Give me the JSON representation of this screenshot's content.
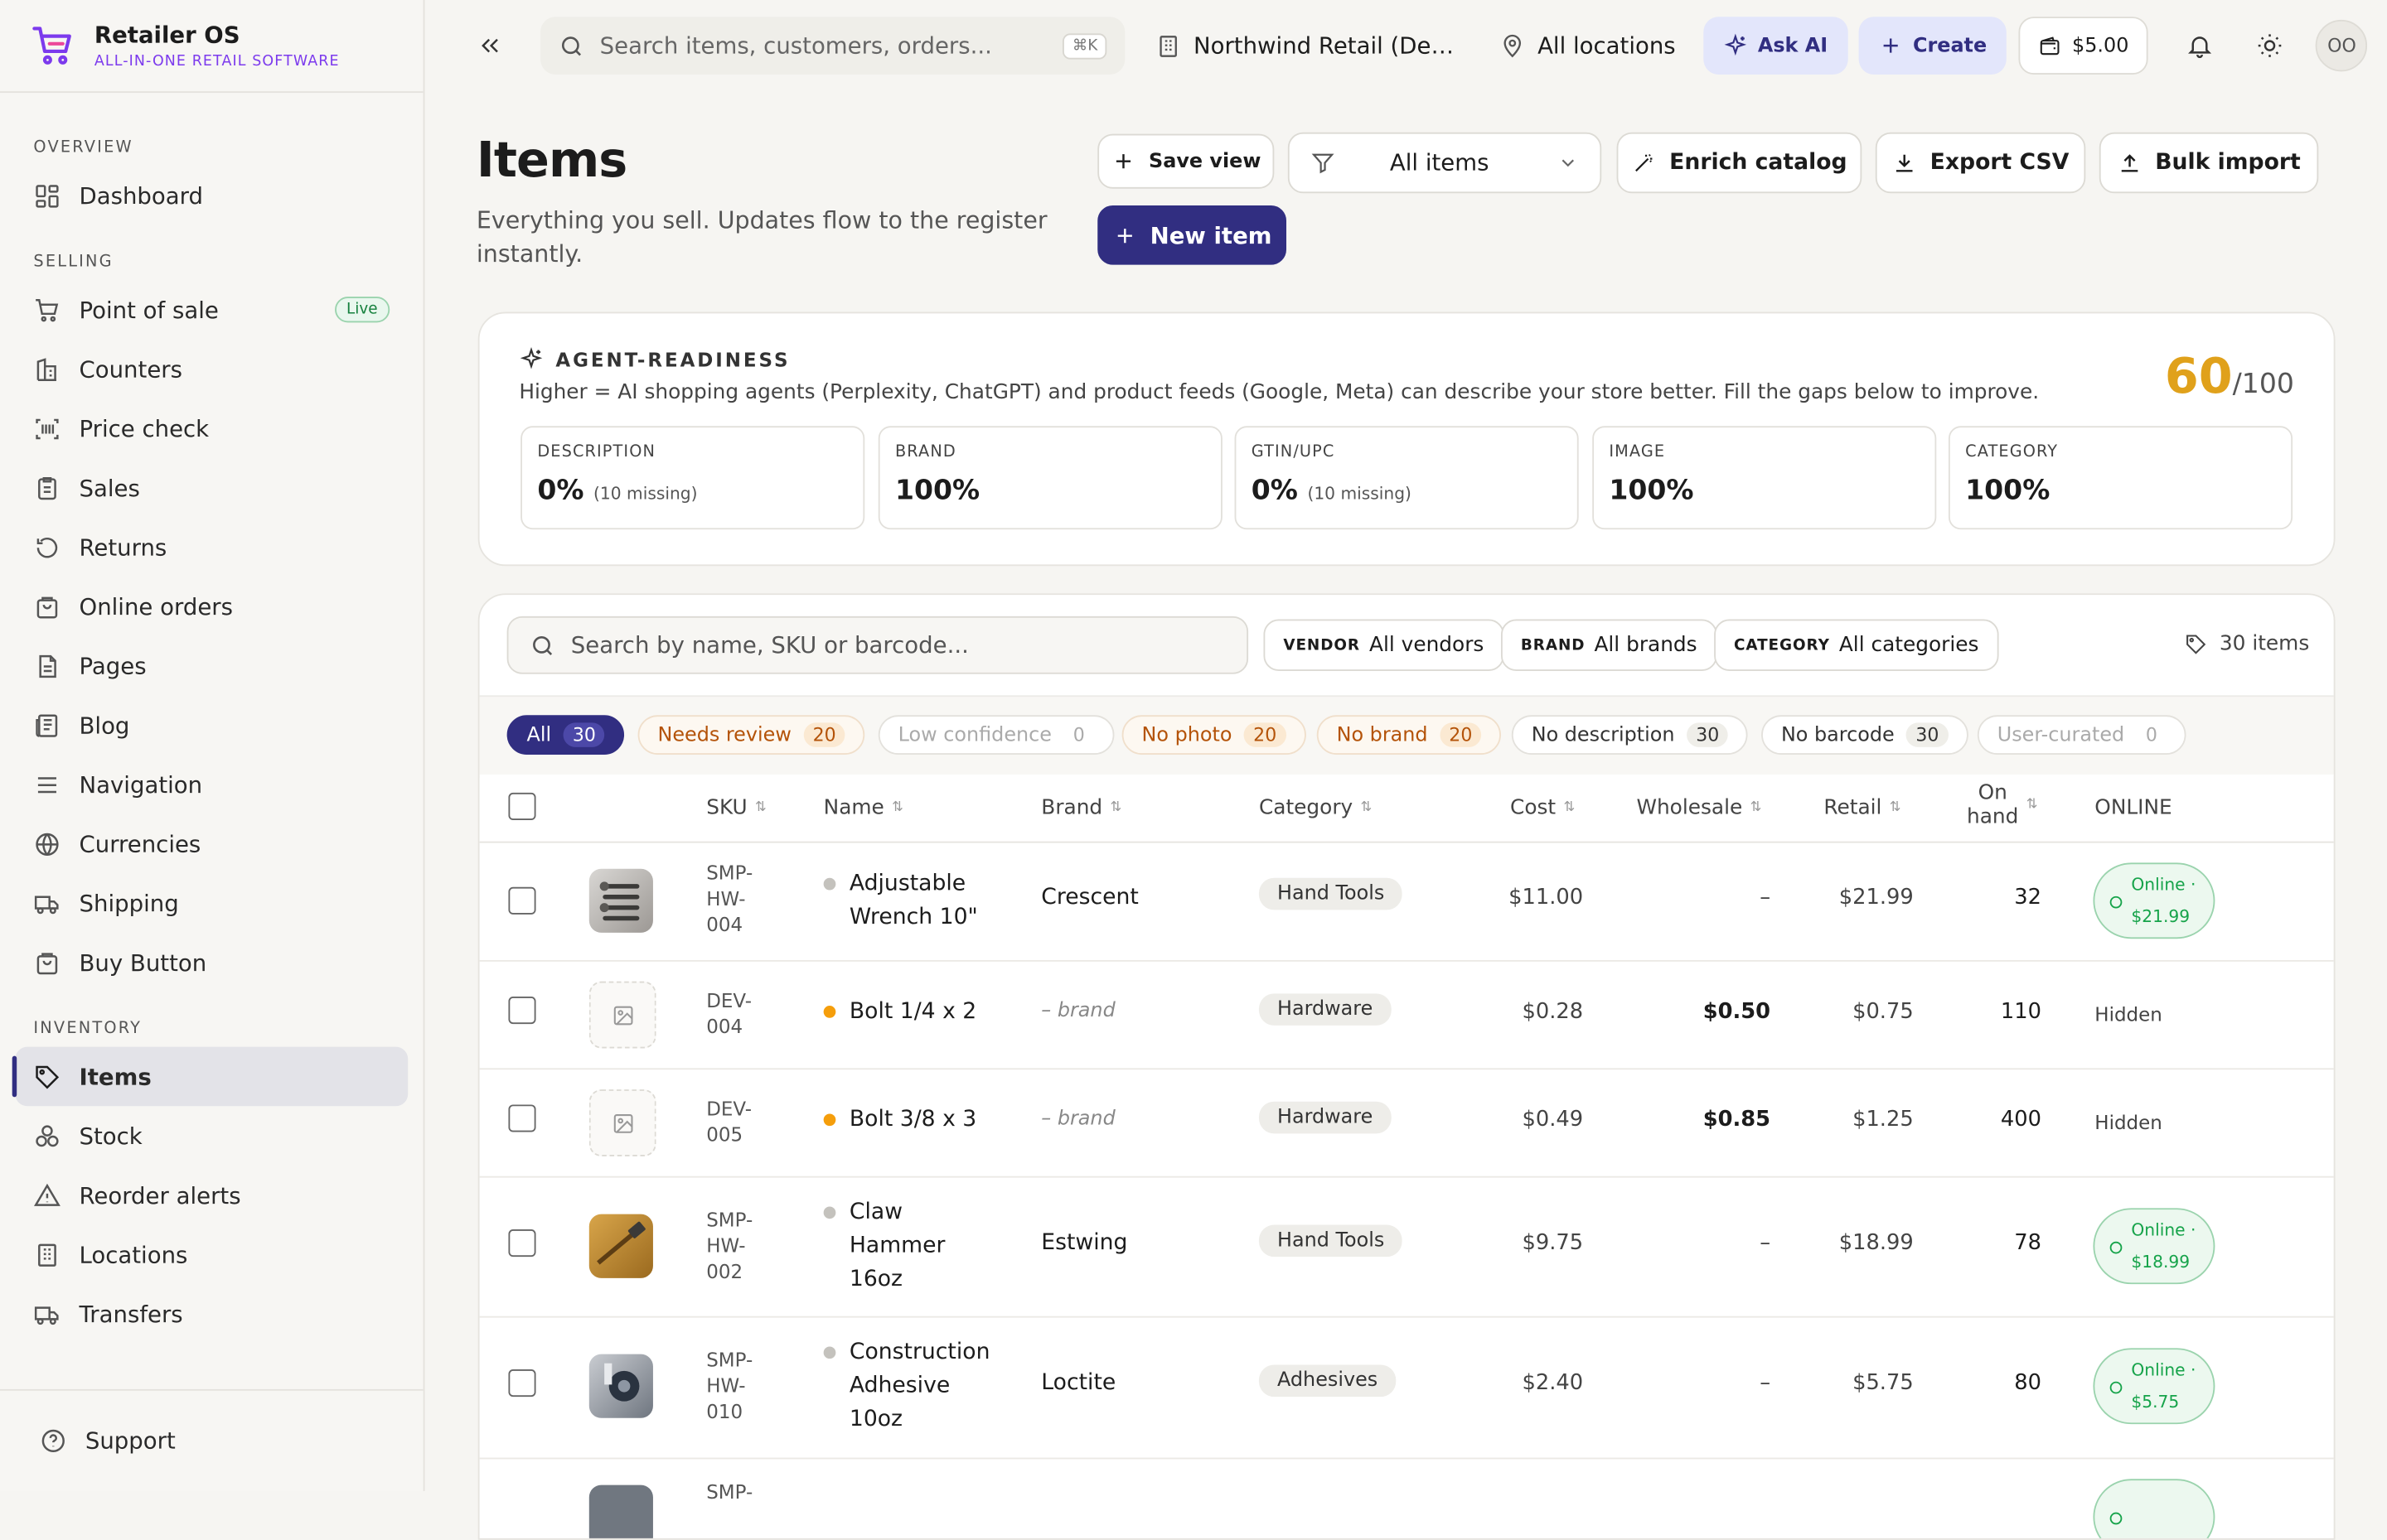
{
  "app": {
    "name": "Retailer OS",
    "tagline": "ALL-IN-ONE RETAIL SOFTWARE"
  },
  "sidebar": {
    "sections": {
      "overview": "OVERVIEW",
      "selling": "SELLING",
      "inventory": "INVENTORY"
    },
    "items": [
      {
        "label": "Dashboard"
      },
      {
        "label": "Point of sale",
        "badge": "Live"
      },
      {
        "label": "Counters"
      },
      {
        "label": "Price check"
      },
      {
        "label": "Sales"
      },
      {
        "label": "Returns"
      },
      {
        "label": "Online orders"
      },
      {
        "label": "Pages"
      },
      {
        "label": "Blog"
      },
      {
        "label": "Navigation"
      },
      {
        "label": "Currencies"
      },
      {
        "label": "Shipping"
      },
      {
        "label": "Buy Button"
      },
      {
        "label": "Items",
        "active": true
      },
      {
        "label": "Stock"
      },
      {
        "label": "Reorder alerts"
      },
      {
        "label": "Locations"
      },
      {
        "label": "Transfers"
      }
    ],
    "footer": "Support"
  },
  "topbar": {
    "search_placeholder": "Search items, customers, orders...",
    "shortcut": "⌘K",
    "org": "Northwind Retail (Demo)",
    "location": "All locations",
    "ask_ai": "Ask AI",
    "create": "Create",
    "balance": "$5.00",
    "avatar": "OO"
  },
  "header": {
    "title": "Items",
    "subtitle": "Everything you sell. Updates flow to the register instantly.",
    "save_view": "Save view",
    "view_select": "All items",
    "enrich": "Enrich catalog",
    "export": "Export CSV",
    "bulk_import": "Bulk import",
    "new_item": "New item"
  },
  "readiness": {
    "title": "AGENT-READINESS",
    "description": "Higher = AI shopping agents (Perplexity, ChatGPT) and product feeds (Google, Meta) can describe your store better. Fill the gaps below to improve.",
    "score": "60",
    "score_max": "/100",
    "metrics": [
      {
        "label": "DESCRIPTION",
        "value": "0%",
        "note": "(10 missing)"
      },
      {
        "label": "BRAND",
        "value": "100%",
        "note": ""
      },
      {
        "label": "GTIN/UPC",
        "value": "0%",
        "note": "(10 missing)"
      },
      {
        "label": "IMAGE",
        "value": "100%",
        "note": ""
      },
      {
        "label": "CATEGORY",
        "value": "100%",
        "note": ""
      }
    ]
  },
  "filters": {
    "search_placeholder": "Search by name, SKU or barcode...",
    "vendor_label": "VENDOR",
    "vendor_value": "All vendors",
    "brand_label": "BRAND",
    "brand_value": "All brands",
    "category_label": "CATEGORY",
    "category_value": "All categories",
    "count": "30 items"
  },
  "tabs": [
    {
      "label": "All",
      "count": "30"
    },
    {
      "label": "Needs review",
      "count": "20"
    },
    {
      "label": "Low confidence",
      "count": "0"
    },
    {
      "label": "No photo",
      "count": "20"
    },
    {
      "label": "No brand",
      "count": "20"
    },
    {
      "label": "No description",
      "count": "30"
    },
    {
      "label": "No barcode",
      "count": "30"
    },
    {
      "label": "User-curated",
      "count": "0"
    }
  ],
  "table": {
    "columns": {
      "sku": "SKU",
      "name": "Name",
      "brand": "Brand",
      "category": "Category",
      "cost": "Cost",
      "wholesale": "Wholesale",
      "retail": "Retail",
      "onhand_1": "On",
      "onhand_2": "hand",
      "online": "ONLINE"
    },
    "rows": [
      {
        "sku": [
          "SMP-",
          "HW-",
          "004"
        ],
        "name": "Adjustable Wrench 10\"",
        "brand": "Crescent",
        "category": "Hand Tools",
        "cost": "$11.00",
        "wholesale": "–",
        "retail": "$21.99",
        "onhand": "32",
        "online_1": "Online ·",
        "online_2": "$21.99"
      },
      {
        "sku": [
          "DEV-",
          "004"
        ],
        "name": "Bolt 1/4 x 2",
        "brand": "– brand",
        "category": "Hardware",
        "cost": "$0.28",
        "wholesale": "$0.50",
        "retail": "$0.75",
        "onhand": "110",
        "status": "Hidden"
      },
      {
        "sku": [
          "DEV-",
          "005"
        ],
        "name": "Bolt 3/8 x 3",
        "brand": "– brand",
        "category": "Hardware",
        "cost": "$0.49",
        "wholesale": "$0.85",
        "retail": "$1.25",
        "onhand": "400",
        "status": "Hidden"
      },
      {
        "sku": [
          "SMP-",
          "HW-",
          "002"
        ],
        "name": "Claw Hammer 16oz",
        "brand": "Estwing",
        "category": "Hand Tools",
        "cost": "$9.75",
        "wholesale": "–",
        "retail": "$18.99",
        "onhand": "78",
        "online_1": "Online ·",
        "online_2": "$18.99"
      },
      {
        "sku": [
          "SMP-",
          "HW-",
          "010"
        ],
        "name": "Construction Adhesive 10oz",
        "brand": "Loctite",
        "category": "Adhesives",
        "cost": "$2.40",
        "wholesale": "–",
        "retail": "$5.75",
        "onhand": "80",
        "online_1": "Online ·",
        "online_2": "$5.75"
      },
      {
        "sku": [
          "SMP-"
        ]
      }
    ]
  },
  "colors": {
    "accent": "#312e81",
    "brand": "#7c3aed",
    "score": "#e0a11b",
    "warn": "#b45309",
    "online": "#16a34a"
  }
}
